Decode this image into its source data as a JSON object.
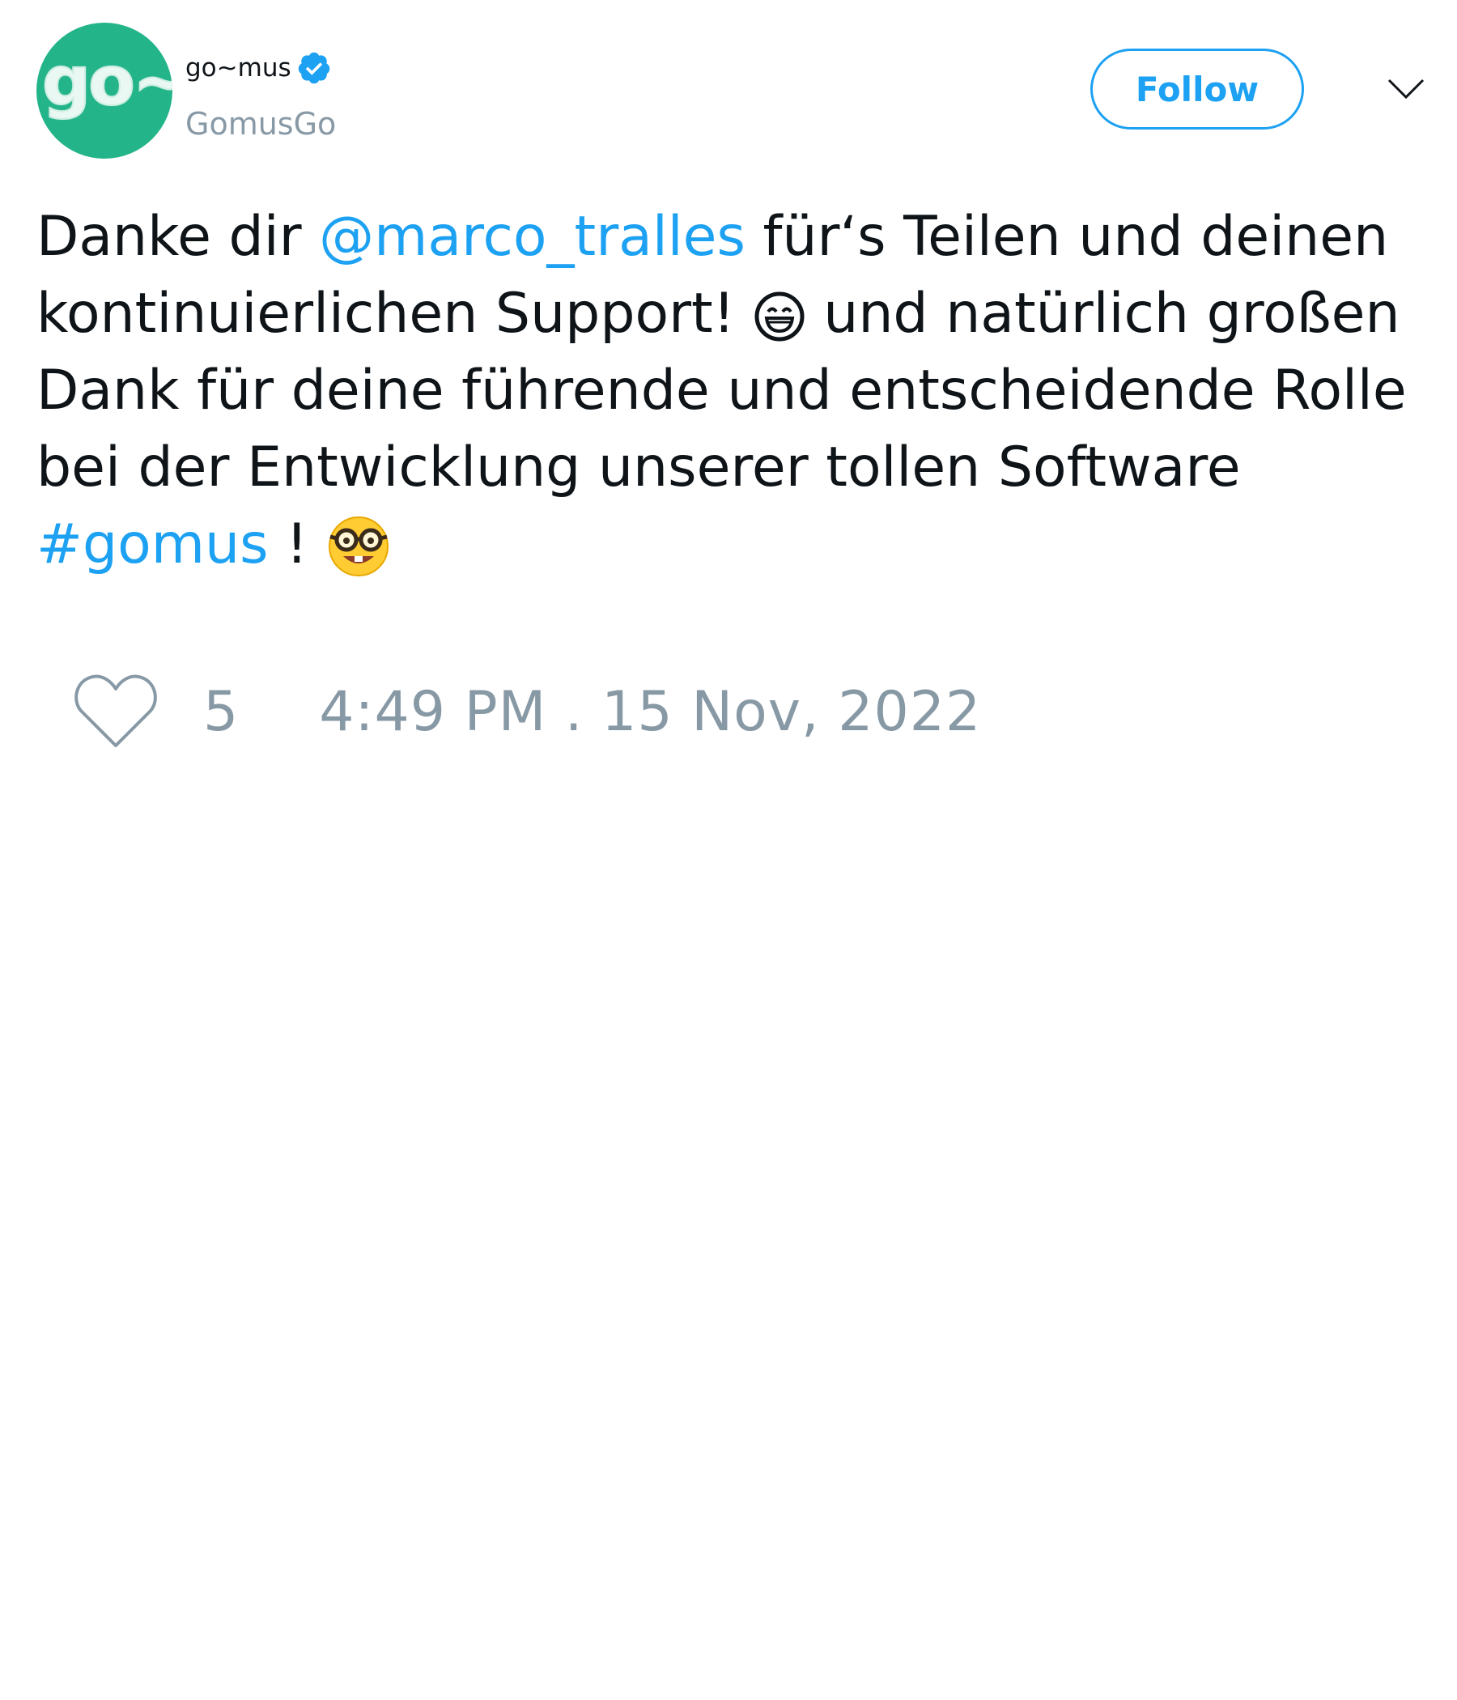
{
  "author": {
    "avatar_text": "go~",
    "display_name": "go~mus",
    "handle": "GomusGo",
    "verified": true
  },
  "actions": {
    "follow_label": "Follow",
    "menu_icon": "chevron-down-icon"
  },
  "tweet": {
    "lines": [
      {
        "t1": "Danke dir ",
        "mention": "@marco_tralles",
        "t2": " für‘s Teilen und deinen"
      },
      {
        "t1": "kontinuierlichen Support! ",
        "emoji": "grinning-face-with-smiling-eyes-emoji",
        "t2": " und natürlich großen"
      },
      {
        "t1": "Dank für deine führende und entscheidende Rolle"
      },
      {
        "t1": "bei der Entwicklung unserer tollen Software"
      },
      {
        "hashtag": "#gomus",
        "t2": " ! ",
        "emoji": "nerd-face-emoji"
      }
    ]
  },
  "footer": {
    "like_icon": "heart-icon",
    "like_count": "5",
    "timestamp": "4:49 PM . 15 Nov, 2022"
  },
  "colors": {
    "brand_blue": "#1da1f2",
    "muted_gray": "#8899a6",
    "avatar_green": "#23b48a",
    "text": "#0f1419"
  }
}
